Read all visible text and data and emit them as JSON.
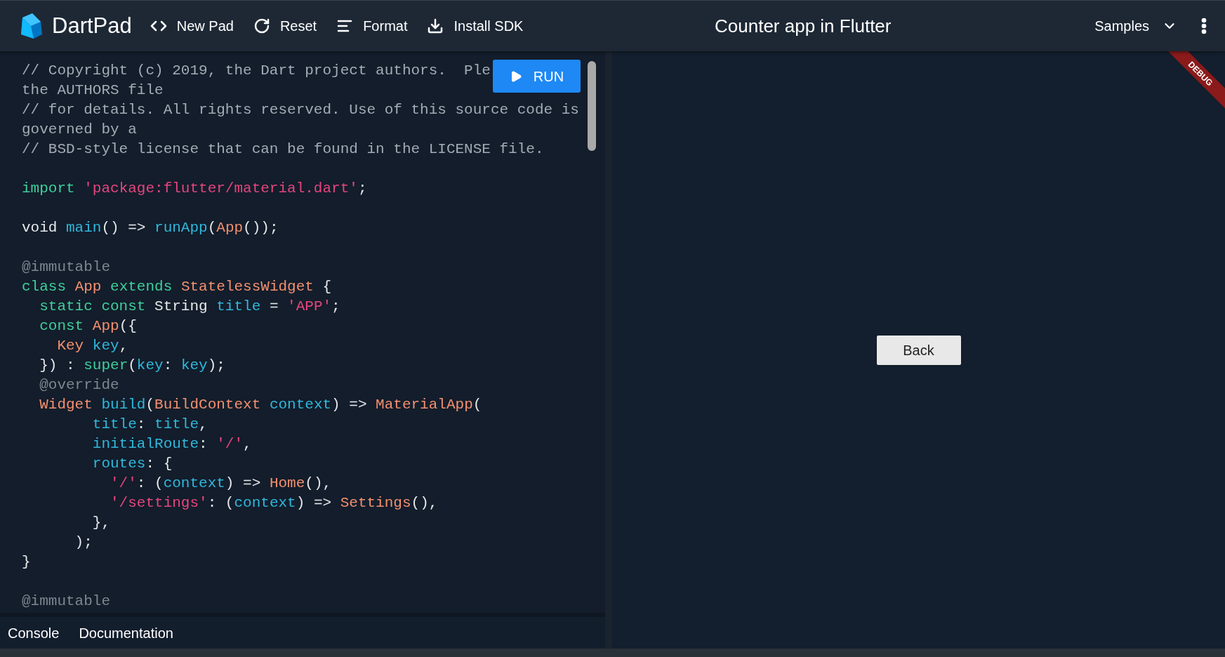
{
  "header": {
    "app_name": "DartPad",
    "actions": [
      {
        "kind": "new",
        "label": "New Pad"
      },
      {
        "kind": "reset",
        "label": "Reset"
      },
      {
        "kind": "format",
        "label": "Format"
      },
      {
        "kind": "install",
        "label": "Install SDK"
      }
    ],
    "title": "Counter app in Flutter",
    "samples": "Samples"
  },
  "editor": {
    "run_button": "RUN",
    "lines": [
      {
        "kind": "code",
        "tokens": [
          {
            "kind": "comment",
            "text": "// Copyright (c) 2019, the Dart project authors.  Ple"
          }
        ]
      },
      {
        "kind": "code",
        "tokens": [
          {
            "kind": "comment",
            "text": "the AUTHORS file"
          }
        ]
      },
      {
        "kind": "code",
        "tokens": [
          {
            "kind": "comment",
            "text": "// for details. All rights reserved. Use of this source code is"
          }
        ]
      },
      {
        "kind": "code",
        "tokens": [
          {
            "kind": "comment",
            "text": "governed by a"
          }
        ]
      },
      {
        "kind": "code",
        "tokens": [
          {
            "kind": "comment",
            "text": "// BSD-style license that can be found in the LICENSE file."
          }
        ]
      },
      {
        "kind": "blank"
      },
      {
        "kind": "code",
        "tokens": [
          {
            "kind": "keyword",
            "text": "import "
          },
          {
            "kind": "string",
            "text": "'package:flutter/material.dart'"
          },
          {
            "kind": "plain",
            "text": ";"
          }
        ]
      },
      {
        "kind": "blank"
      },
      {
        "kind": "code",
        "tokens": [
          {
            "kind": "plain",
            "text": "void "
          },
          {
            "kind": "ident",
            "text": "main"
          },
          {
            "kind": "plain",
            "text": "() => "
          },
          {
            "kind": "ident",
            "text": "runApp"
          },
          {
            "kind": "plain",
            "text": "("
          },
          {
            "kind": "type",
            "text": "App"
          },
          {
            "kind": "plain",
            "text": "());"
          }
        ]
      },
      {
        "kind": "blank"
      },
      {
        "kind": "code",
        "tokens": [
          {
            "kind": "annotation",
            "text": "@immutable"
          }
        ]
      },
      {
        "kind": "code",
        "tokens": [
          {
            "kind": "keyword",
            "text": "class "
          },
          {
            "kind": "type",
            "text": "App "
          },
          {
            "kind": "keyword",
            "text": "extends "
          },
          {
            "kind": "type",
            "text": "StatelessWidget"
          },
          {
            "kind": "plain",
            "text": " {"
          }
        ]
      },
      {
        "kind": "code",
        "tokens": [
          {
            "kind": "keyword",
            "text": "  static const"
          },
          {
            "kind": "plain",
            "text": " String "
          },
          {
            "kind": "ident",
            "text": "title"
          },
          {
            "kind": "plain",
            "text": " = "
          },
          {
            "kind": "string",
            "text": "'APP'"
          },
          {
            "kind": "plain",
            "text": ";"
          }
        ]
      },
      {
        "kind": "code",
        "tokens": [
          {
            "kind": "keyword",
            "text": "  const "
          },
          {
            "kind": "type",
            "text": "App"
          },
          {
            "kind": "plain",
            "text": "({"
          }
        ]
      },
      {
        "kind": "code",
        "tokens": [
          {
            "kind": "type",
            "text": "    Key "
          },
          {
            "kind": "ident",
            "text": "key"
          },
          {
            "kind": "plain",
            "text": ","
          }
        ]
      },
      {
        "kind": "code",
        "tokens": [
          {
            "kind": "plain",
            "text": "  }) : "
          },
          {
            "kind": "keyword",
            "text": "super"
          },
          {
            "kind": "plain",
            "text": "("
          },
          {
            "kind": "ident",
            "text": "key"
          },
          {
            "kind": "plain",
            "text": ": "
          },
          {
            "kind": "ident",
            "text": "key"
          },
          {
            "kind": "plain",
            "text": ");"
          }
        ]
      },
      {
        "kind": "code",
        "tokens": [
          {
            "kind": "annotation",
            "text": "  @override"
          }
        ]
      },
      {
        "kind": "code",
        "tokens": [
          {
            "kind": "type",
            "text": "  Widget "
          },
          {
            "kind": "ident",
            "text": "build"
          },
          {
            "kind": "plain",
            "text": "("
          },
          {
            "kind": "type",
            "text": "BuildContext "
          },
          {
            "kind": "ident",
            "text": "context"
          },
          {
            "kind": "plain",
            "text": ") => "
          },
          {
            "kind": "type",
            "text": "MaterialApp"
          },
          {
            "kind": "plain",
            "text": "("
          }
        ]
      },
      {
        "kind": "code",
        "tokens": [
          {
            "kind": "ident",
            "text": "        title"
          },
          {
            "kind": "plain",
            "text": ": "
          },
          {
            "kind": "ident",
            "text": "title"
          },
          {
            "kind": "plain",
            "text": ","
          }
        ]
      },
      {
        "kind": "code",
        "tokens": [
          {
            "kind": "ident",
            "text": "        initialRoute"
          },
          {
            "kind": "plain",
            "text": ": "
          },
          {
            "kind": "string",
            "text": "'/'"
          },
          {
            "kind": "plain",
            "text": ","
          }
        ]
      },
      {
        "kind": "code",
        "tokens": [
          {
            "kind": "ident",
            "text": "        routes"
          },
          {
            "kind": "plain",
            "text": ": {"
          }
        ]
      },
      {
        "kind": "code",
        "tokens": [
          {
            "kind": "string",
            "text": "          '/'"
          },
          {
            "kind": "plain",
            "text": ": ("
          },
          {
            "kind": "ident",
            "text": "context"
          },
          {
            "kind": "plain",
            "text": ") => "
          },
          {
            "kind": "type",
            "text": "Home"
          },
          {
            "kind": "plain",
            "text": "(),"
          }
        ]
      },
      {
        "kind": "code",
        "tokens": [
          {
            "kind": "string",
            "text": "          '/settings'"
          },
          {
            "kind": "plain",
            "text": ": ("
          },
          {
            "kind": "ident",
            "text": "context"
          },
          {
            "kind": "plain",
            "text": ") => "
          },
          {
            "kind": "type",
            "text": "Settings"
          },
          {
            "kind": "plain",
            "text": "(),"
          }
        ]
      },
      {
        "kind": "code",
        "tokens": [
          {
            "kind": "plain",
            "text": "        },"
          }
        ]
      },
      {
        "kind": "code",
        "tokens": [
          {
            "kind": "plain",
            "text": "      );"
          }
        ]
      },
      {
        "kind": "code",
        "tokens": [
          {
            "kind": "plain",
            "text": "}"
          }
        ]
      },
      {
        "kind": "blank"
      },
      {
        "kind": "code",
        "tokens": [
          {
            "kind": "annotation",
            "text": "@immutable"
          }
        ]
      }
    ]
  },
  "bottom_tabs": [
    "Console",
    "Documentation"
  ],
  "preview": {
    "button": "Back",
    "banner": "DEBUG"
  }
}
